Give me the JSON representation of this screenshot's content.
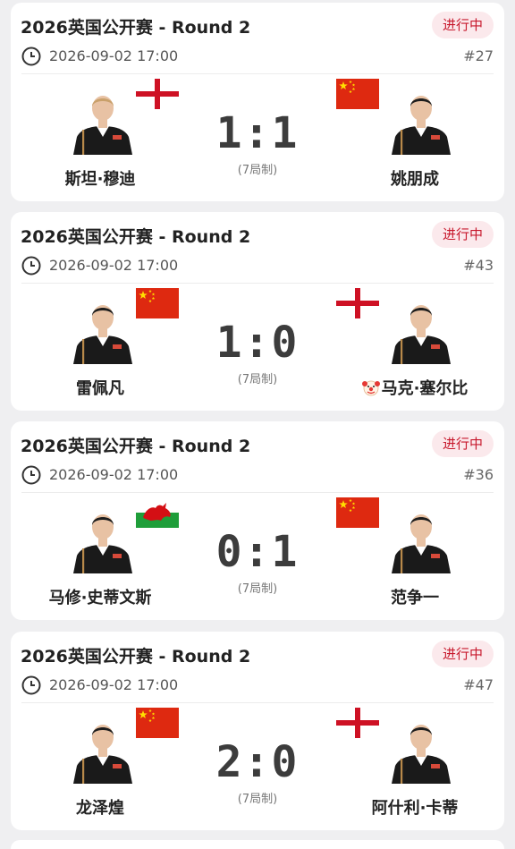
{
  "matches": [
    {
      "title": "2026英国公开赛 - Round 2",
      "status": "进行中",
      "time": "2026-09-02 17:00",
      "match_no": "#27",
      "left_player": {
        "name": "斯坦·穆迪",
        "flag": "england",
        "clown": false
      },
      "right_player": {
        "name": "姚朋成",
        "flag": "china",
        "clown": false
      },
      "score": "1:1",
      "format": "(7局制)"
    },
    {
      "title": "2026英国公开赛 - Round 2",
      "status": "进行中",
      "time": "2026-09-02 17:00",
      "match_no": "#43",
      "left_player": {
        "name": "雷佩凡",
        "flag": "china",
        "clown": false
      },
      "right_player": {
        "name": "马克·塞尔比",
        "flag": "england",
        "clown": true
      },
      "score": "1:0",
      "format": "(7局制)"
    },
    {
      "title": "2026英国公开赛 - Round 2",
      "status": "进行中",
      "time": "2026-09-02 17:00",
      "match_no": "#36",
      "left_player": {
        "name": "马修·史蒂文斯",
        "flag": "wales",
        "clown": false
      },
      "right_player": {
        "name": "范争一",
        "flag": "china",
        "clown": false
      },
      "score": "0:1",
      "format": "(7局制)"
    },
    {
      "title": "2026英国公开赛 - Round 2",
      "status": "进行中",
      "time": "2026-09-02 17:00",
      "match_no": "#47",
      "left_player": {
        "name": "龙泽煌",
        "flag": "china",
        "clown": false
      },
      "right_player": {
        "name": "阿什利·卡蒂",
        "flag": "england",
        "clown": false
      },
      "score": "2:0",
      "format": "(7局制)"
    }
  ],
  "colors": {
    "status_red": "#c7182c",
    "status_bg": "#fbe9ec",
    "china_red": "#de2910",
    "england_red": "#ce1124"
  }
}
